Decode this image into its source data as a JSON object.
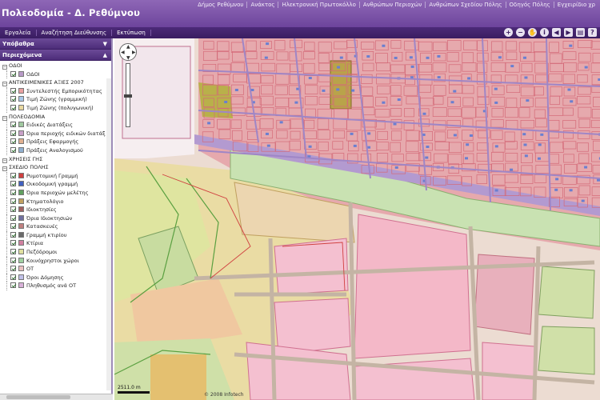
{
  "header": {
    "title": "Πολεοδομία - Δ. Ρεθύμνου",
    "links": [
      "Δήμος Ρεθύμνου",
      "Ανάκτος",
      "Ηλεκτρονική Πρωτοκόλλο",
      "Ανθρώπων Περιοχών",
      "Ανθρώπων Σχεδίου Πόλης",
      "Οδηγός Πόλης",
      "Εγχειρίδιο χρ"
    ]
  },
  "menubar": {
    "items": [
      "Εργαλεία",
      "Αναζήτηση Διεύθυνσης",
      "Εκτύπωση"
    ],
    "tools": [
      "zoom-in",
      "zoom-out",
      "pan",
      "identify",
      "previous",
      "next",
      "print",
      "help"
    ]
  },
  "sidebar": {
    "top_header": "Υπόβαθρα",
    "layers_header": "Περιεχόμενα",
    "rows": [
      {
        "type": "group",
        "label": "ΟΔΟΙ"
      },
      {
        "type": "child",
        "label": "ΟΔΟΙ",
        "color": "#b89ac8"
      },
      {
        "type": "group",
        "label": "ΑΝΤΙΚΕΙΜΕΝΙΚΕΣ ΑΞΙΕΣ 2007"
      },
      {
        "type": "child",
        "label": "Συντελεστής Εμπορικότητας",
        "color": "#e8a0a0"
      },
      {
        "type": "child",
        "label": "Τιμή Ζώνης (γραμμική)",
        "color": "#a8c8e8"
      },
      {
        "type": "child",
        "label": "Τιμή Ζώνης (πολυγωνική)",
        "color": "#e8d8a0"
      },
      {
        "type": "group",
        "label": "ΠΟΛΕΟΔΟΜΙΑ"
      },
      {
        "type": "child",
        "label": "Ειδικές Διατάξεις",
        "color": "#a0c8a0"
      },
      {
        "type": "child",
        "label": "Όρια περιοχής ειδικών διατάξ",
        "color": "#c8a0c8"
      },
      {
        "type": "child",
        "label": "Πράξεις Εφαρμογής",
        "color": "#e0b090"
      },
      {
        "type": "child",
        "label": "Πράξεις Αναλογισμού",
        "color": "#90b0d0"
      },
      {
        "type": "group",
        "label": "ΧΡΗΣΕΙΣ ΓΗΣ"
      },
      {
        "type": "group",
        "label": "ΣΧΕΔΙΟ ΠΟΛΗΣ"
      },
      {
        "type": "child",
        "label": "Ρυμοτομική Γραμμή",
        "color": "#d04040"
      },
      {
        "type": "child",
        "label": "Οικοδομική γραμμή",
        "color": "#4060c0"
      },
      {
        "type": "child",
        "label": "Όρια περιοχών μελέτης",
        "color": "#60a060"
      },
      {
        "type": "child",
        "label": "Κτηματολόγιο",
        "color": "#c0a060"
      },
      {
        "type": "child",
        "label": "Ιδιοκτησίες",
        "color": "#a06060"
      },
      {
        "type": "child",
        "label": "Όρια Ιδιοκτησιών",
        "color": "#7070a0"
      },
      {
        "type": "child",
        "label": "Κατασκευές",
        "color": "#c08080"
      },
      {
        "type": "child",
        "label": "Γραμμή κτιρίου",
        "color": "#6a6a6a"
      },
      {
        "type": "child",
        "label": "Κτίρια",
        "color": "#d080a0"
      },
      {
        "type": "child",
        "label": "Πεζόδρομοι",
        "color": "#e0e0a0"
      },
      {
        "type": "child",
        "label": "Κοινόχρηστοι χώροι",
        "color": "#a0d0a0"
      },
      {
        "type": "child",
        "label": "ΟΤ",
        "color": "#e8c0c0"
      },
      {
        "type": "child",
        "label": "Όροι Δόμησης",
        "color": "#c0c0e8"
      },
      {
        "type": "child",
        "label": "Πληθυσμός ανά ΟΤ",
        "color": "#d8b0d8"
      }
    ]
  },
  "map": {
    "scale_label": "2511.0 m",
    "copyright": "© 2008 Infotech"
  },
  "colors": {
    "header_top": "#8e67b6",
    "menubar": "#4c2a78",
    "accent": "#6b4a97"
  }
}
